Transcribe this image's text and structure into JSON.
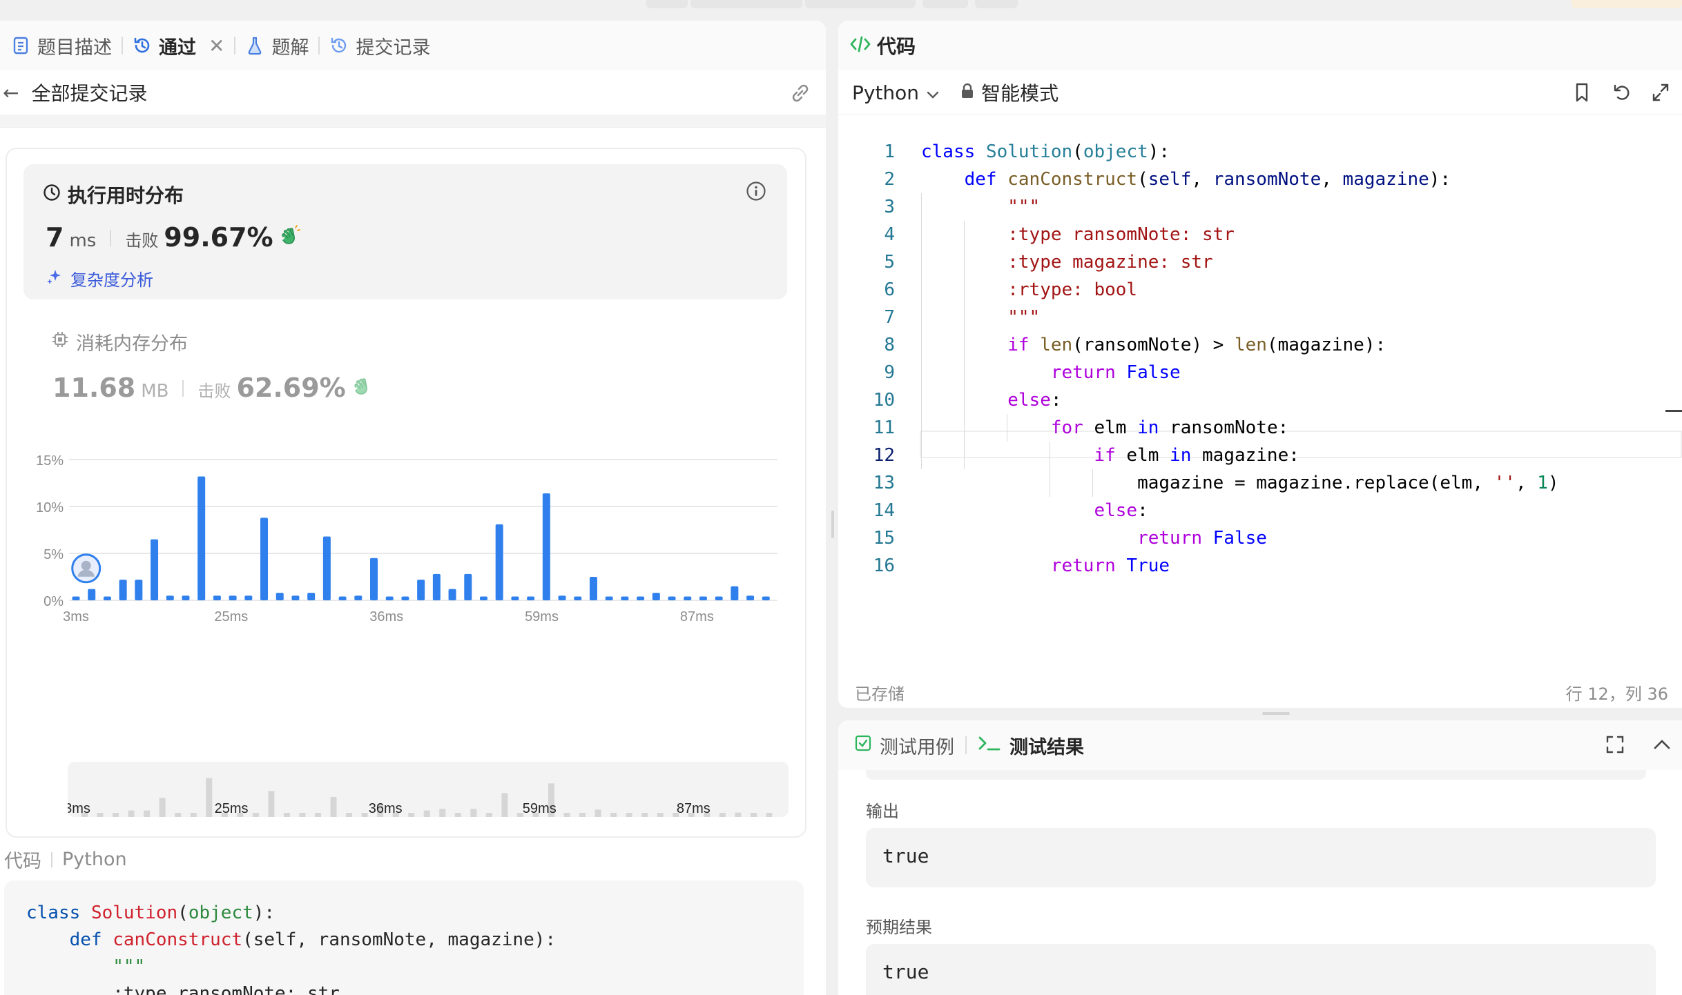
{
  "colors": {
    "accent_blue": "#2f80ed",
    "link_blue": "#3b5bdb",
    "accepted_green": "#2db55d"
  },
  "left_panel": {
    "tabs": [
      {
        "label": "题目描述",
        "icon": "doc-icon"
      },
      {
        "label": "通过",
        "icon": "history-icon",
        "active": true
      },
      {
        "label": "题解",
        "icon": "flask-icon"
      },
      {
        "label": "提交记录",
        "icon": "history-icon"
      }
    ],
    "subbar_title": "全部提交记录",
    "runtime": {
      "title": "执行用时分布",
      "value": "7",
      "unit": "ms",
      "beat_label": "击败",
      "beat_value": "99.67%",
      "complexity_link": "复杂度分析"
    },
    "memory": {
      "title": "消耗内存分布",
      "value": "11.68",
      "unit": "MB",
      "beat_label": "击败",
      "beat_value": "62.69%"
    },
    "code_header": {
      "label": "代码",
      "language": "Python"
    },
    "code_preview": [
      "class Solution(object):",
      "    def canConstruct(self, ransomNote, magazine):",
      "        \"\"\"",
      "        :type ransomNote: str"
    ]
  },
  "chart_data": {
    "type": "bar",
    "title": "",
    "xlabel": "",
    "ylabel": "",
    "ylim": [
      0,
      15
    ],
    "y_ticks": [
      "0%",
      "5%",
      "10%",
      "15%"
    ],
    "x_tick_labels": [
      "3ms",
      "25ms",
      "36ms",
      "59ms",
      "87ms"
    ],
    "y_grid": true,
    "highlighted_bar_index": 1,
    "values": [
      0.4,
      1.2,
      0.4,
      2.2,
      2.2,
      6.5,
      0.5,
      0.5,
      13.2,
      0.5,
      0.5,
      0.5,
      8.8,
      0.8,
      0.5,
      0.8,
      6.8,
      0.4,
      0.5,
      4.5,
      0.4,
      0.4,
      2.2,
      2.8,
      1.2,
      2.8,
      0.4,
      8.1,
      0.4,
      0.4,
      11.4,
      0.5,
      0.4,
      2.5,
      0.4,
      0.4,
      0.4,
      0.8,
      0.4,
      0.4,
      0.4,
      0.4,
      1.5,
      0.5,
      0.4
    ]
  },
  "mini_chart": {
    "labels": [
      "3ms",
      "25ms",
      "36ms",
      "59ms",
      "87ms"
    ]
  },
  "editor": {
    "title": "代码",
    "language": "Python",
    "mode": "智能模式",
    "line_numbers": [
      "1",
      "2",
      "3",
      "4",
      "5",
      "6",
      "7",
      "8",
      "9",
      "10",
      "11",
      "12",
      "13",
      "14",
      "15",
      "16"
    ],
    "current_line": 12,
    "saved_status": "已存储",
    "cursor_position": "行 12，列 36"
  },
  "bottom_panel": {
    "tab_testcase": "测试用例",
    "tab_result": "测试结果",
    "output_label": "输出",
    "output_value": "true",
    "expected_label": "预期结果",
    "expected_value": "true"
  }
}
